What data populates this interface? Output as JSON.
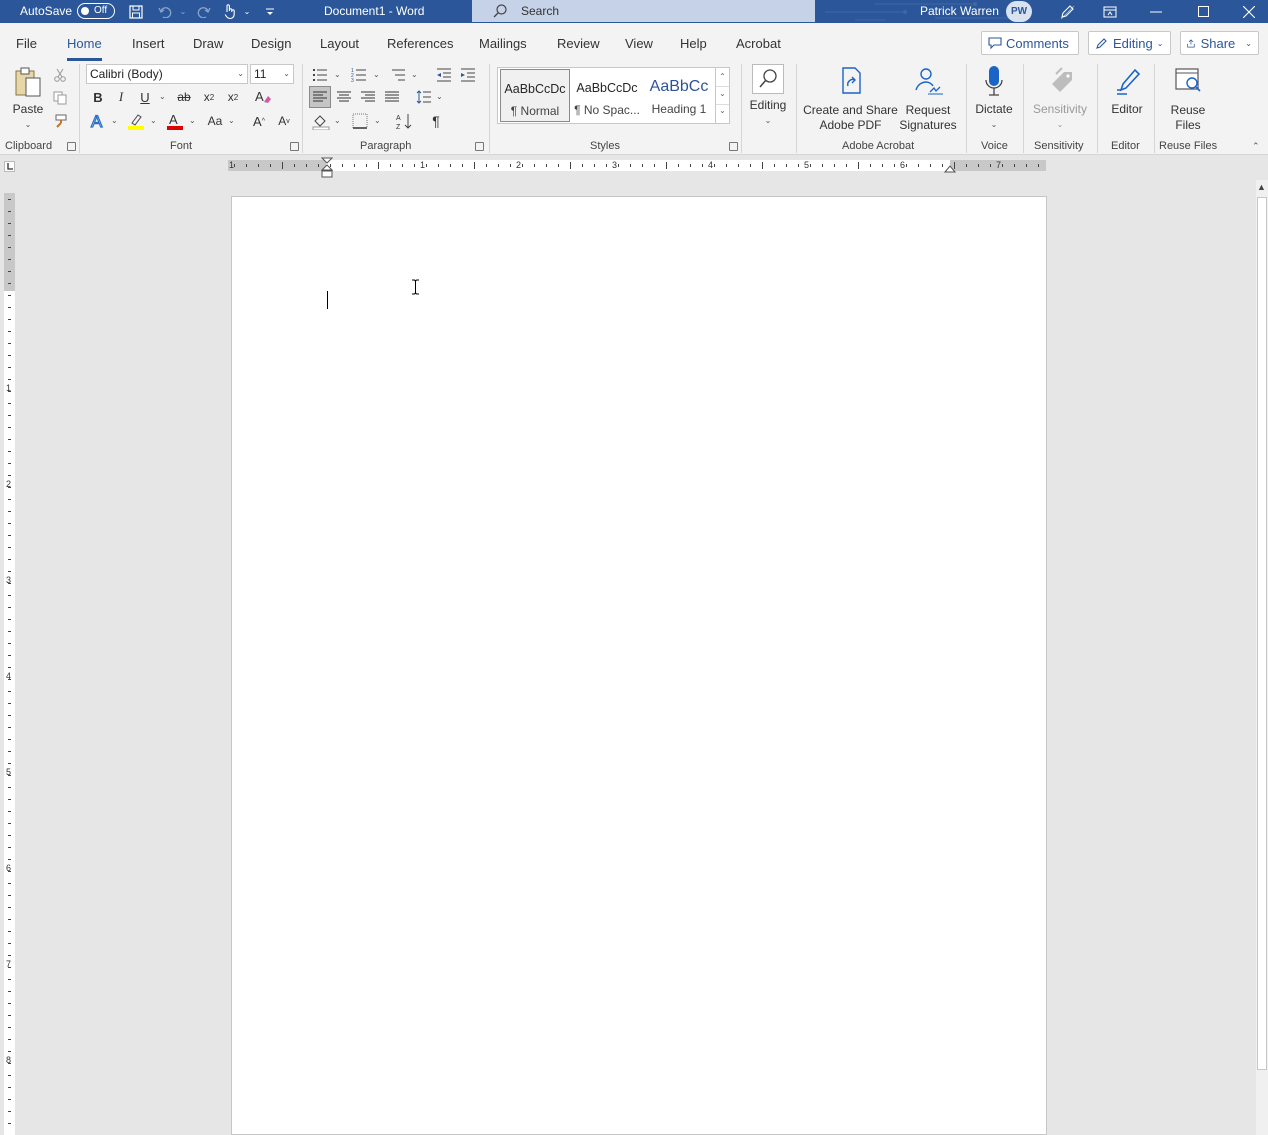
{
  "titlebar": {
    "autosave_label": "AutoSave",
    "autosave_state": "Off",
    "document_title": "Document1  -  Word",
    "search_placeholder": "Search",
    "user_name": "Patrick Warren",
    "user_initials": "PW"
  },
  "tabs": [
    "File",
    "Home",
    "Insert",
    "Draw",
    "Design",
    "Layout",
    "References",
    "Mailings",
    "Review",
    "View",
    "Help",
    "Acrobat"
  ],
  "active_tab": "Home",
  "top_buttons": {
    "comments": "Comments",
    "editing": "Editing",
    "share": "Share"
  },
  "clipboard": {
    "paste": "Paste",
    "group": "Clipboard"
  },
  "font": {
    "name": "Calibri (Body)",
    "size": "11",
    "group": "Font"
  },
  "paragraph": {
    "group": "Paragraph"
  },
  "styles": {
    "items": [
      {
        "preview": "AaBbCcDc",
        "name": "¶ Normal"
      },
      {
        "preview": "AaBbCcDc",
        "name": "¶ No Spac..."
      },
      {
        "preview": "AaBbCc",
        "name": "Heading 1"
      }
    ],
    "group": "Styles"
  },
  "editing_label": "Editing",
  "acrobat": {
    "create_line1": "Create and Share",
    "create_line2": "Adobe PDF",
    "request_line1": "Request",
    "request_line2": "Signatures",
    "group": "Adobe Acrobat"
  },
  "voice": {
    "dictate": "Dictate",
    "group": "Voice"
  },
  "sensitivity": {
    "label": "Sensitivity",
    "group": "Sensitivity"
  },
  "editor": {
    "label": "Editor",
    "group": "Editor"
  },
  "reuse": {
    "line1": "Reuse",
    "line2": "Files",
    "group": "Reuse Files"
  },
  "ruler": {
    "h_numbers": [
      "1",
      "1",
      "2",
      "3",
      "4",
      "5",
      "6",
      "7"
    ],
    "v_numbers": [
      "1",
      "2",
      "3",
      "4",
      "5",
      "6",
      "7",
      "8"
    ]
  },
  "colors": {
    "brand": "#2b579a",
    "highlight": "#ffff00",
    "font_color": "#e00000",
    "acrobat_blue": "#1a64c8"
  }
}
